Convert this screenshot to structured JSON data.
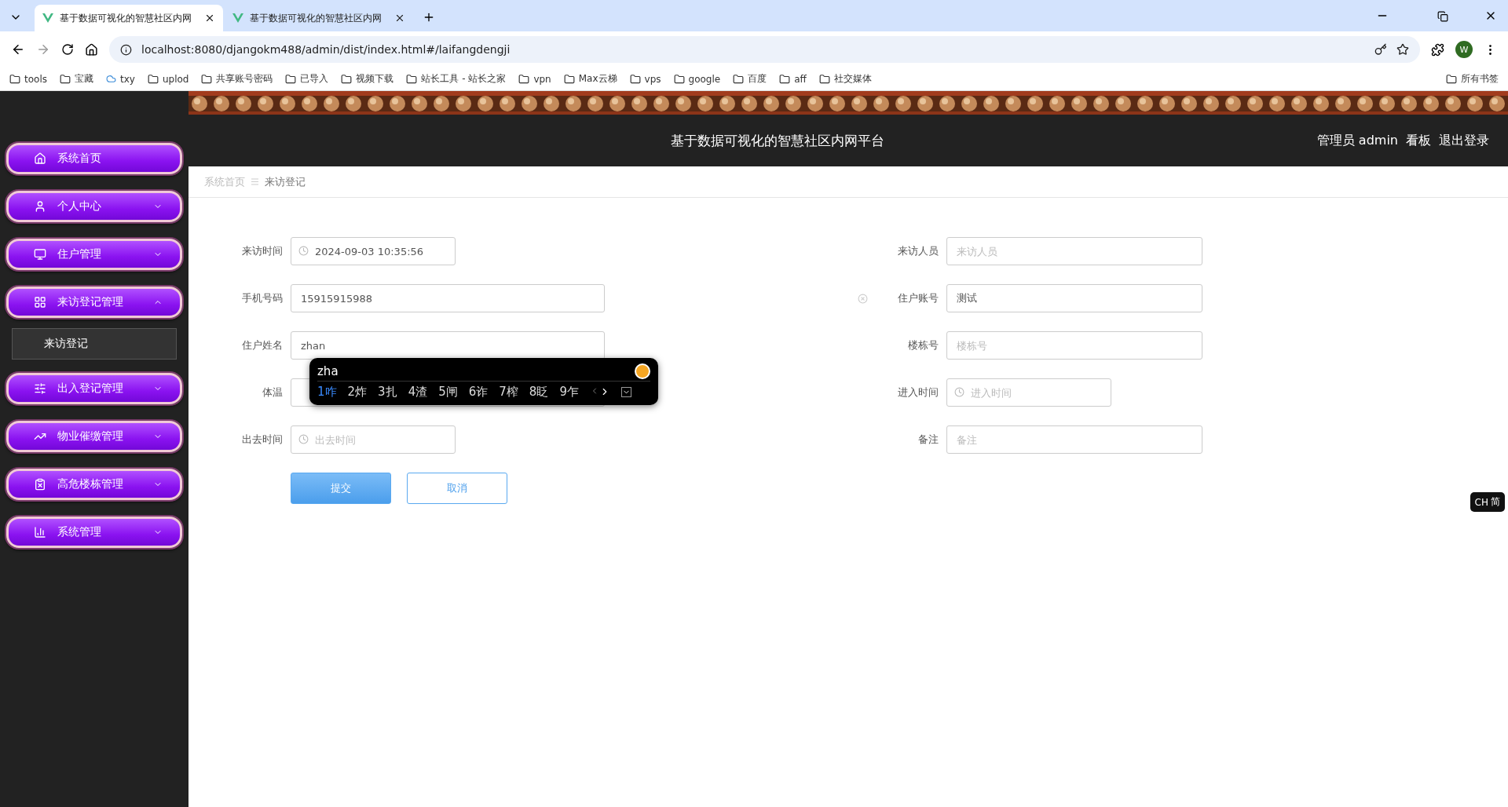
{
  "browser": {
    "tabs": [
      {
        "title": "基于数据可视化的智慧社区内网",
        "selected": true
      },
      {
        "title": "基于数据可视化的智慧社区内网",
        "selected": false
      }
    ],
    "url": "localhost:8080/djangokm488/admin/dist/index.html#/laifangdengji",
    "profile": "W",
    "bookmarks": [
      "tools",
      "宝藏",
      "txy",
      "uplod",
      "共享账号密码",
      "已导入",
      "视频下载",
      "站长工具 - 站长之家",
      "vpn",
      "Max云梯",
      "vps",
      "google",
      "百度",
      "aff",
      "社交媒体"
    ],
    "all_bookmarks": "所有书签"
  },
  "header": {
    "title": "基于数据可视化的智慧社区内网平台",
    "user": "管理员 admin",
    "links": [
      "看板",
      "退出登录"
    ]
  },
  "sidebar": {
    "items": [
      {
        "label": "系统首页",
        "kind": "link"
      },
      {
        "label": "个人中心",
        "kind": "menu",
        "expanded": false
      },
      {
        "label": "住户管理",
        "kind": "menu",
        "expanded": false
      },
      {
        "label": "来访登记管理",
        "kind": "menu",
        "expanded": true,
        "children": [
          {
            "label": "来访登记",
            "selected": true
          }
        ]
      },
      {
        "label": "出入登记管理",
        "kind": "menu",
        "expanded": false
      },
      {
        "label": "物业催缴管理",
        "kind": "menu",
        "expanded": false
      },
      {
        "label": "高危楼栋管理",
        "kind": "menu",
        "expanded": false
      },
      {
        "label": "系统管理",
        "kind": "menu",
        "expanded": false
      }
    ]
  },
  "breadcrumb": [
    "系统首页",
    "来访登记"
  ],
  "form": {
    "rows": [
      [
        {
          "label": "来访时间",
          "kind": "date",
          "value": "2024-09-03 10:35:56"
        },
        {
          "label": "来访人员",
          "kind": "text",
          "placeholder": "来访人员"
        }
      ],
      [
        {
          "label": "手机号码",
          "kind": "text",
          "value": "15915915988",
          "clearable": true
        },
        {
          "label": "住户账号",
          "kind": "text",
          "value": "测试"
        }
      ],
      [
        {
          "label": "住户姓名",
          "kind": "text",
          "value": "zhan"
        },
        {
          "label": "楼栋号",
          "kind": "text",
          "placeholder": "楼栋号"
        }
      ],
      [
        {
          "label": "体温",
          "kind": "text"
        },
        {
          "label": "进入时间",
          "kind": "date",
          "placeholder": "进入时间"
        }
      ],
      [
        {
          "label": "出去时间",
          "kind": "date",
          "placeholder": "出去时间"
        },
        {
          "label": "备注",
          "kind": "text",
          "placeholder": "备注"
        }
      ]
    ],
    "buttons": [
      {
        "label": "提交",
        "kind": "primary"
      },
      {
        "label": "取消",
        "kind": "secondary"
      }
    ]
  },
  "ime": {
    "composition": "zha",
    "candidates": [
      {
        "text": "1咋",
        "selected": true
      },
      {
        "text": "2炸",
        "selected": false
      },
      {
        "text": "3扎",
        "selected": false
      },
      {
        "text": "4渣",
        "selected": false
      },
      {
        "text": "5闸",
        "selected": false
      },
      {
        "text": "6诈",
        "selected": false
      },
      {
        "text": "7榨",
        "selected": false
      },
      {
        "text": "8眨",
        "selected": false
      },
      {
        "text": "9乍",
        "selected": false
      }
    ],
    "mode": "CH",
    "script": "简"
  }
}
